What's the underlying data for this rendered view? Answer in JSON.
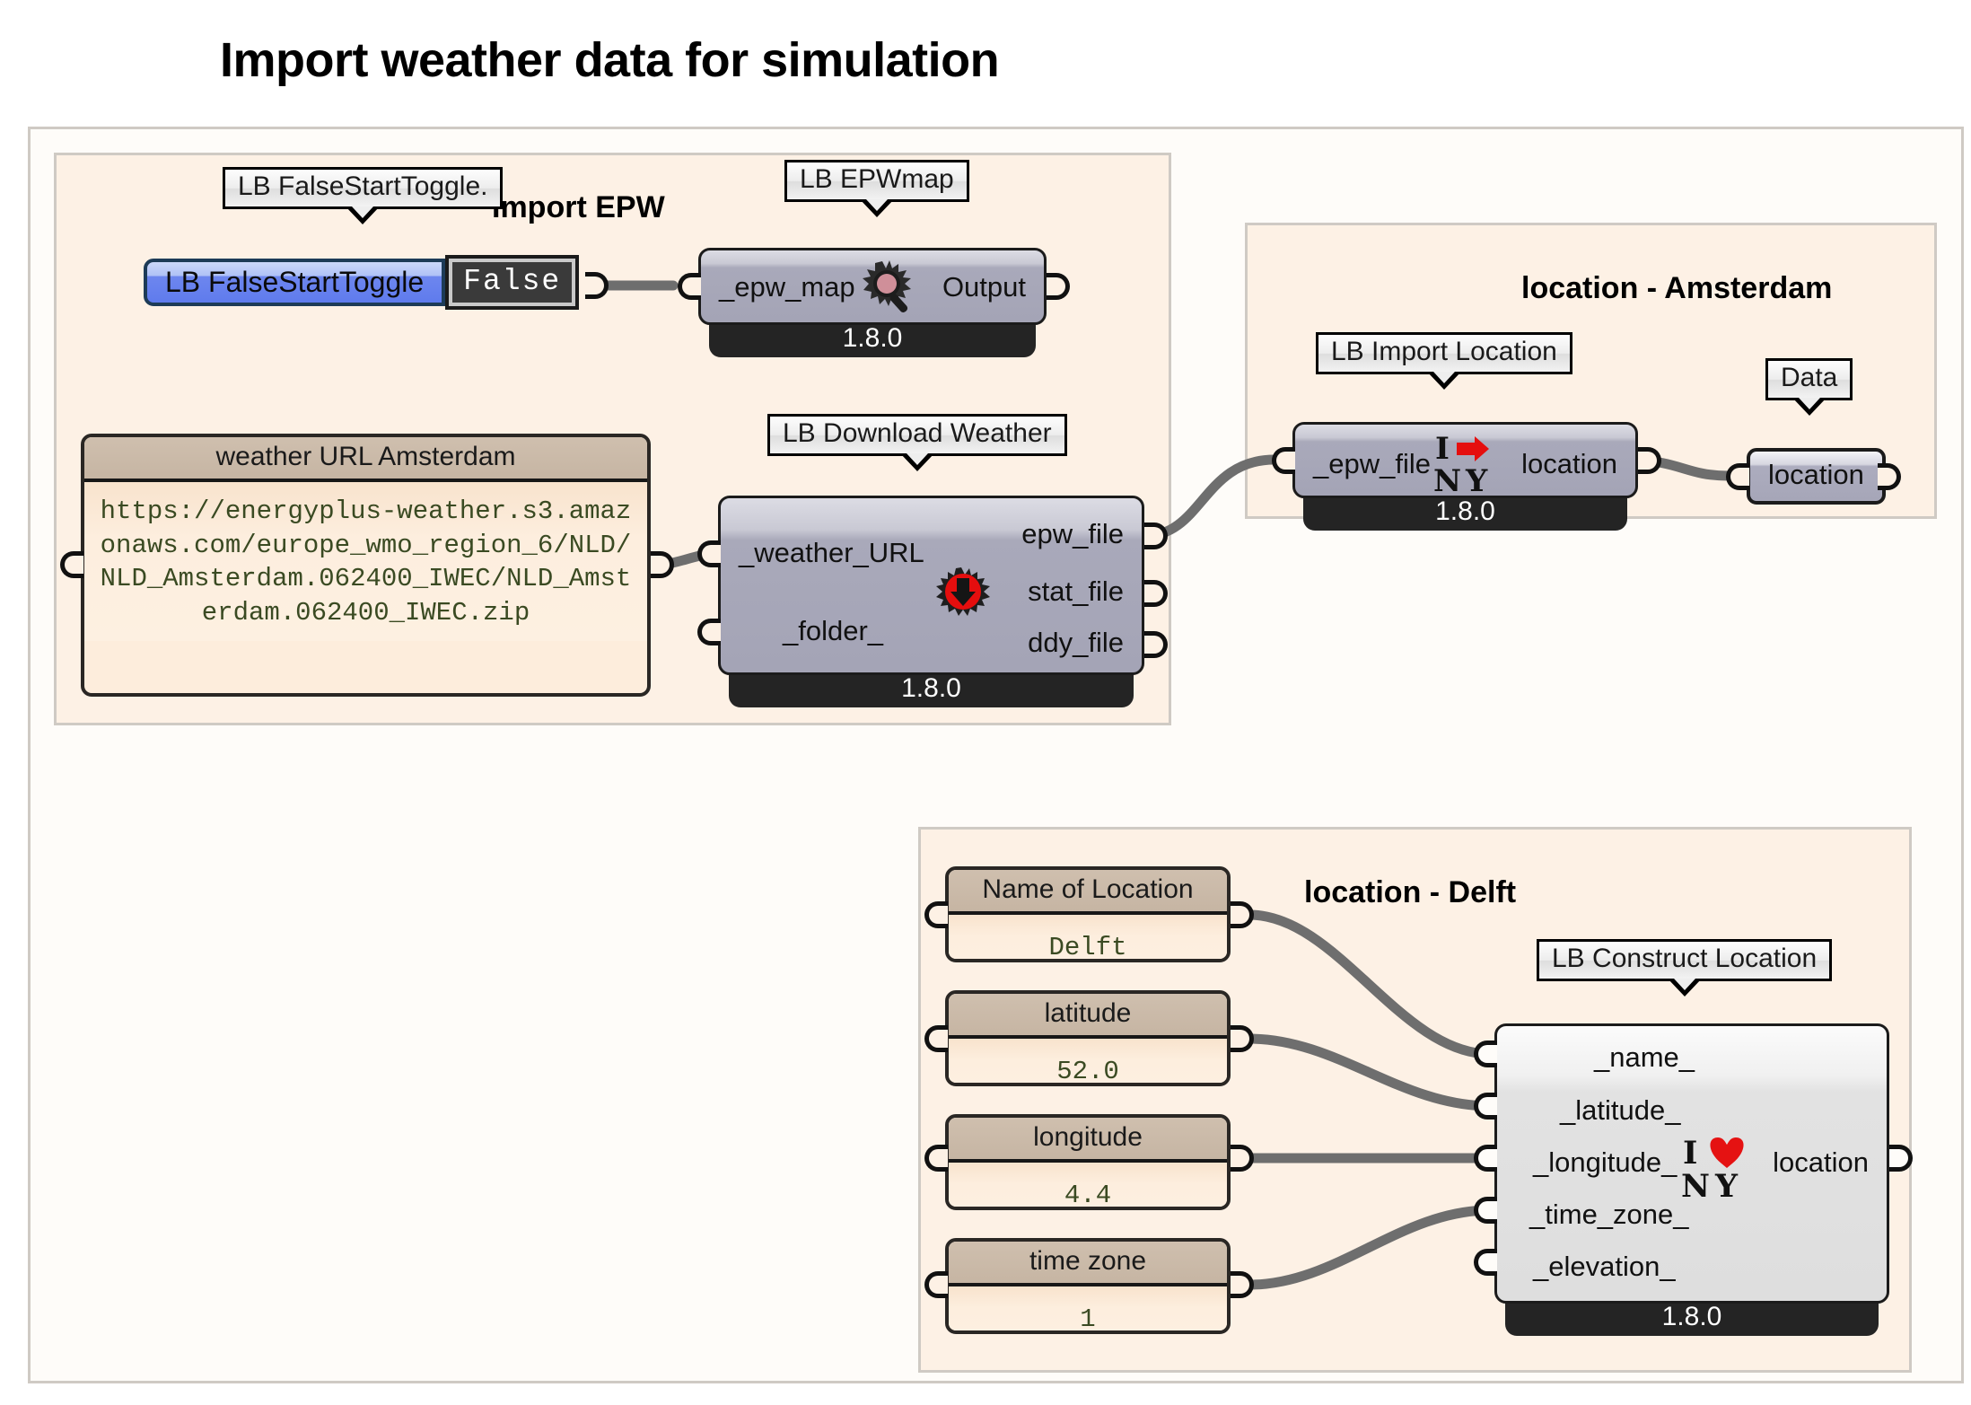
{
  "page": {
    "title": "Import weather data for simulation"
  },
  "groups": {
    "import_epw": {
      "title": "Import EPW"
    },
    "location_amsterdam": {
      "title": "location - Amsterdam"
    },
    "location_delft": {
      "title": "location - Delft"
    }
  },
  "callouts": {
    "false_start_toggle": "LB FalseStartToggle.",
    "epwmap": "LB EPWmap",
    "download_weather": "LB Download Weather",
    "import_location": "LB Import Location",
    "data": "Data",
    "construct_location": "LB Construct Location"
  },
  "toggle": {
    "label": "LB FalseStartToggle",
    "value": "False"
  },
  "components": {
    "epwmap": {
      "inputs": [
        "_epw_map"
      ],
      "outputs": [
        "Output"
      ],
      "version": "1.8.0",
      "icon": "magnifier-icon"
    },
    "download_weather": {
      "inputs": [
        "_weather_URL",
        "_folder_"
      ],
      "outputs": [
        "epw_file",
        "stat_file",
        "ddy_file"
      ],
      "version": "1.8.0",
      "icon": "download-arrow-icon"
    },
    "import_location": {
      "inputs": [
        "_epw_file"
      ],
      "outputs": [
        "location"
      ],
      "version": "1.8.0",
      "icon": "i-arrow-ny-icon"
    },
    "construct_location": {
      "inputs": [
        "_name_",
        "_latitude_",
        "_longitude_",
        "_time_zone_",
        "_elevation_"
      ],
      "outputs": [
        "location"
      ],
      "version": "1.8.0",
      "icon": "i-heart-ny-icon"
    }
  },
  "params": {
    "location_out": "location"
  },
  "panels": {
    "weather_url": {
      "title": "weather URL Amsterdam",
      "value": "https://energyplus-weather.s3.amazonaws.com/europe_wmo_region_6/NLD/NLD_Amsterdam.062400_IWEC/NLD_Amsterdam.062400_IWEC.zip"
    },
    "name_of_location": {
      "title": "Name of Location",
      "value": "Delft"
    },
    "latitude": {
      "title": "latitude",
      "value": "52.0"
    },
    "longitude": {
      "title": "longitude",
      "value": "4.4"
    },
    "time_zone": {
      "title": "time zone",
      "value": "1"
    }
  },
  "colors": {
    "canvas_bg": "#fefcf9",
    "group_bg": "#fdf1e5",
    "group_border": "#cfcac4",
    "component_body": "#a4a4b6",
    "component_footer": "#242424",
    "toggle_blue": "#5f7bed",
    "wire": "#6e6e6e",
    "panel_value_text": "#3a4a22",
    "panel_head": "#c6b5a3",
    "accent_red": "#e02020"
  }
}
